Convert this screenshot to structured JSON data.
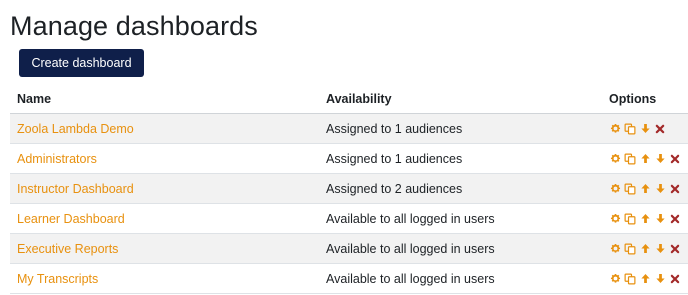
{
  "page": {
    "title": "Manage dashboards",
    "create_button_label": "Create dashboard"
  },
  "table": {
    "headers": {
      "name": "Name",
      "availability": "Availability",
      "options": "Options"
    },
    "rows": [
      {
        "name": "Zoola Lambda Demo",
        "availability": "Assigned to 1 audiences",
        "actions": [
          "settings",
          "copy",
          "move-down",
          "delete"
        ]
      },
      {
        "name": "Administrators",
        "availability": "Assigned to 1 audiences",
        "actions": [
          "settings",
          "copy",
          "move-up",
          "move-down",
          "delete"
        ]
      },
      {
        "name": "Instructor Dashboard",
        "availability": "Assigned to 2 audiences",
        "actions": [
          "settings",
          "copy",
          "move-up",
          "move-down",
          "delete"
        ]
      },
      {
        "name": "Learner Dashboard",
        "availability": "Available to all logged in users",
        "actions": [
          "settings",
          "copy",
          "move-up",
          "move-down",
          "delete"
        ]
      },
      {
        "name": "Executive Reports",
        "availability": "Available to all logged in users",
        "actions": [
          "settings",
          "copy",
          "move-up",
          "move-down",
          "delete"
        ]
      },
      {
        "name": "My Transcripts",
        "availability": "Available to all logged in users",
        "actions": [
          "settings",
          "copy",
          "move-up",
          "move-down",
          "delete"
        ]
      }
    ]
  },
  "colors": {
    "link": "#e8910f",
    "icon_orange": "#e8910f",
    "delete_red": "#a32a2a",
    "button_bg": "#0f1f4a",
    "stripe": "#f2f2f2"
  }
}
